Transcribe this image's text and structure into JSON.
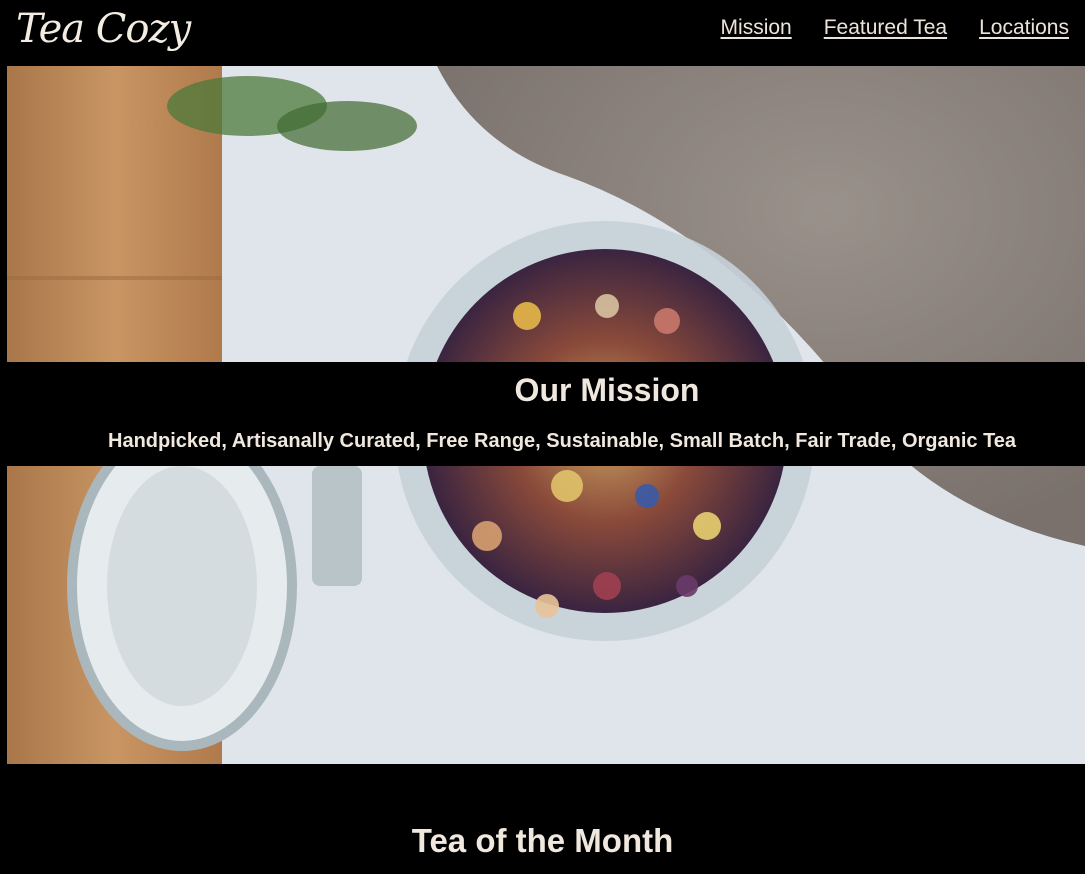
{
  "header": {
    "logo": "Tea Cozy",
    "nav": [
      {
        "label": "Mission"
      },
      {
        "label": "Featured Tea"
      },
      {
        "label": "Locations"
      }
    ]
  },
  "mission": {
    "title": "Our Mission",
    "subtitle": "Handpicked, Artisanally Curated, Free Range, Sustainable, Small Batch, Fair Trade, Organic Tea"
  },
  "featured": {
    "title": "Tea of the Month"
  },
  "colors": {
    "background": "#000000",
    "text": "#f0e8de"
  }
}
